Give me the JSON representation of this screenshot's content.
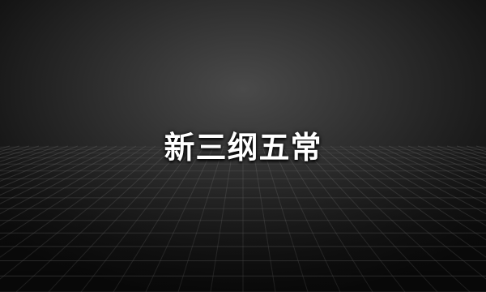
{
  "title": "新三纲五常",
  "colors": {
    "text": "#ffffff",
    "background_center": "#4a4a4a",
    "background_edge": "#0c0c0c",
    "grid_line": "#6a6a6a"
  }
}
